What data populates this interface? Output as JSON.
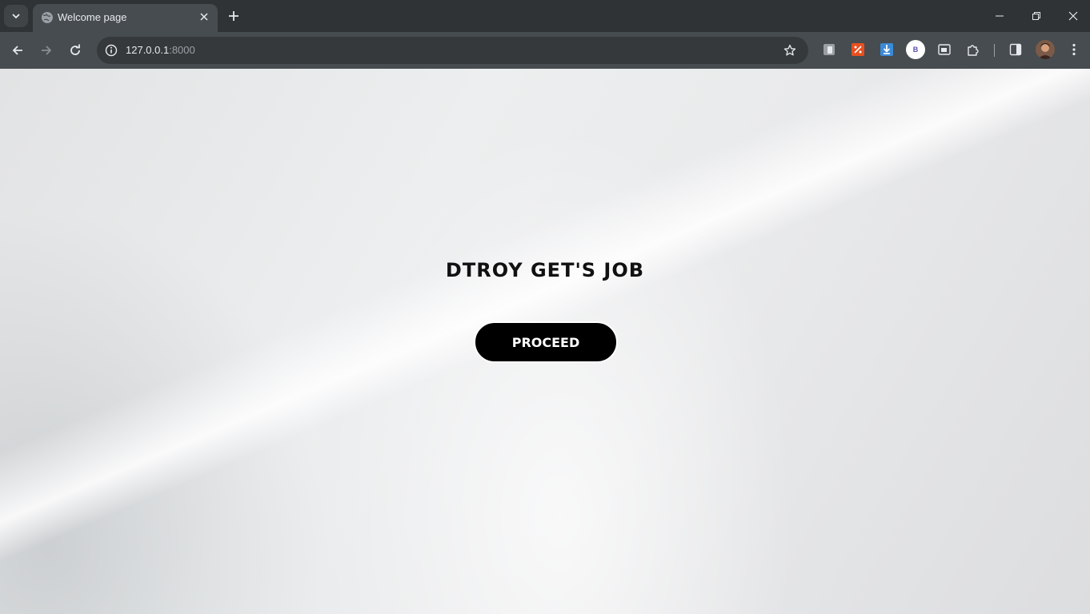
{
  "browser": {
    "tab": {
      "title": "Welcome page"
    },
    "address": {
      "host": "127.0.0.1",
      "port": ":8000"
    },
    "extensions": {
      "avatar_letter": "B"
    }
  },
  "page": {
    "headline": "DTROY GET'S JOB",
    "proceed_label": "PROCEED"
  }
}
